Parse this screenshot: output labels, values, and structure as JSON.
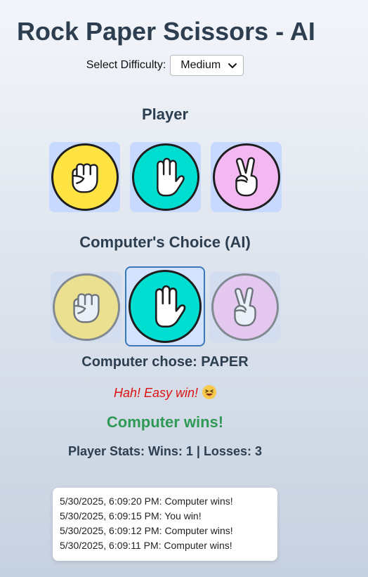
{
  "title": "Rock Paper Scissors - AI",
  "difficulty": {
    "label": "Select Difficulty:",
    "selected": "Medium"
  },
  "player": {
    "heading": "Player",
    "choices": [
      {
        "name": "rock",
        "icon": "fist-icon",
        "color": "#ffe342"
      },
      {
        "name": "paper",
        "icon": "open-hand-icon",
        "color": "#00ddd1"
      },
      {
        "name": "scissors",
        "icon": "peace-sign-icon",
        "color": "#f3b7f1"
      }
    ]
  },
  "computer": {
    "heading": "Computer's Choice (AI)",
    "selected": "paper",
    "chose_text": "Computer chose: PAPER"
  },
  "taunt": {
    "text": "Hah! Easy win!",
    "emoji": "laughing-face-icon"
  },
  "result": {
    "text": "Computer wins!",
    "color": "#2f9a55"
  },
  "stats": {
    "text": "Player Stats: Wins: 1 | Losses: 3"
  },
  "history": [
    "5/30/2025, 6:09:20 PM: Computer wins!",
    "5/30/2025, 6:09:15 PM: You win!",
    "5/30/2025, 6:09:12 PM: Computer wins!",
    "5/30/2025, 6:09:11 PM: Computer wins!"
  ]
}
